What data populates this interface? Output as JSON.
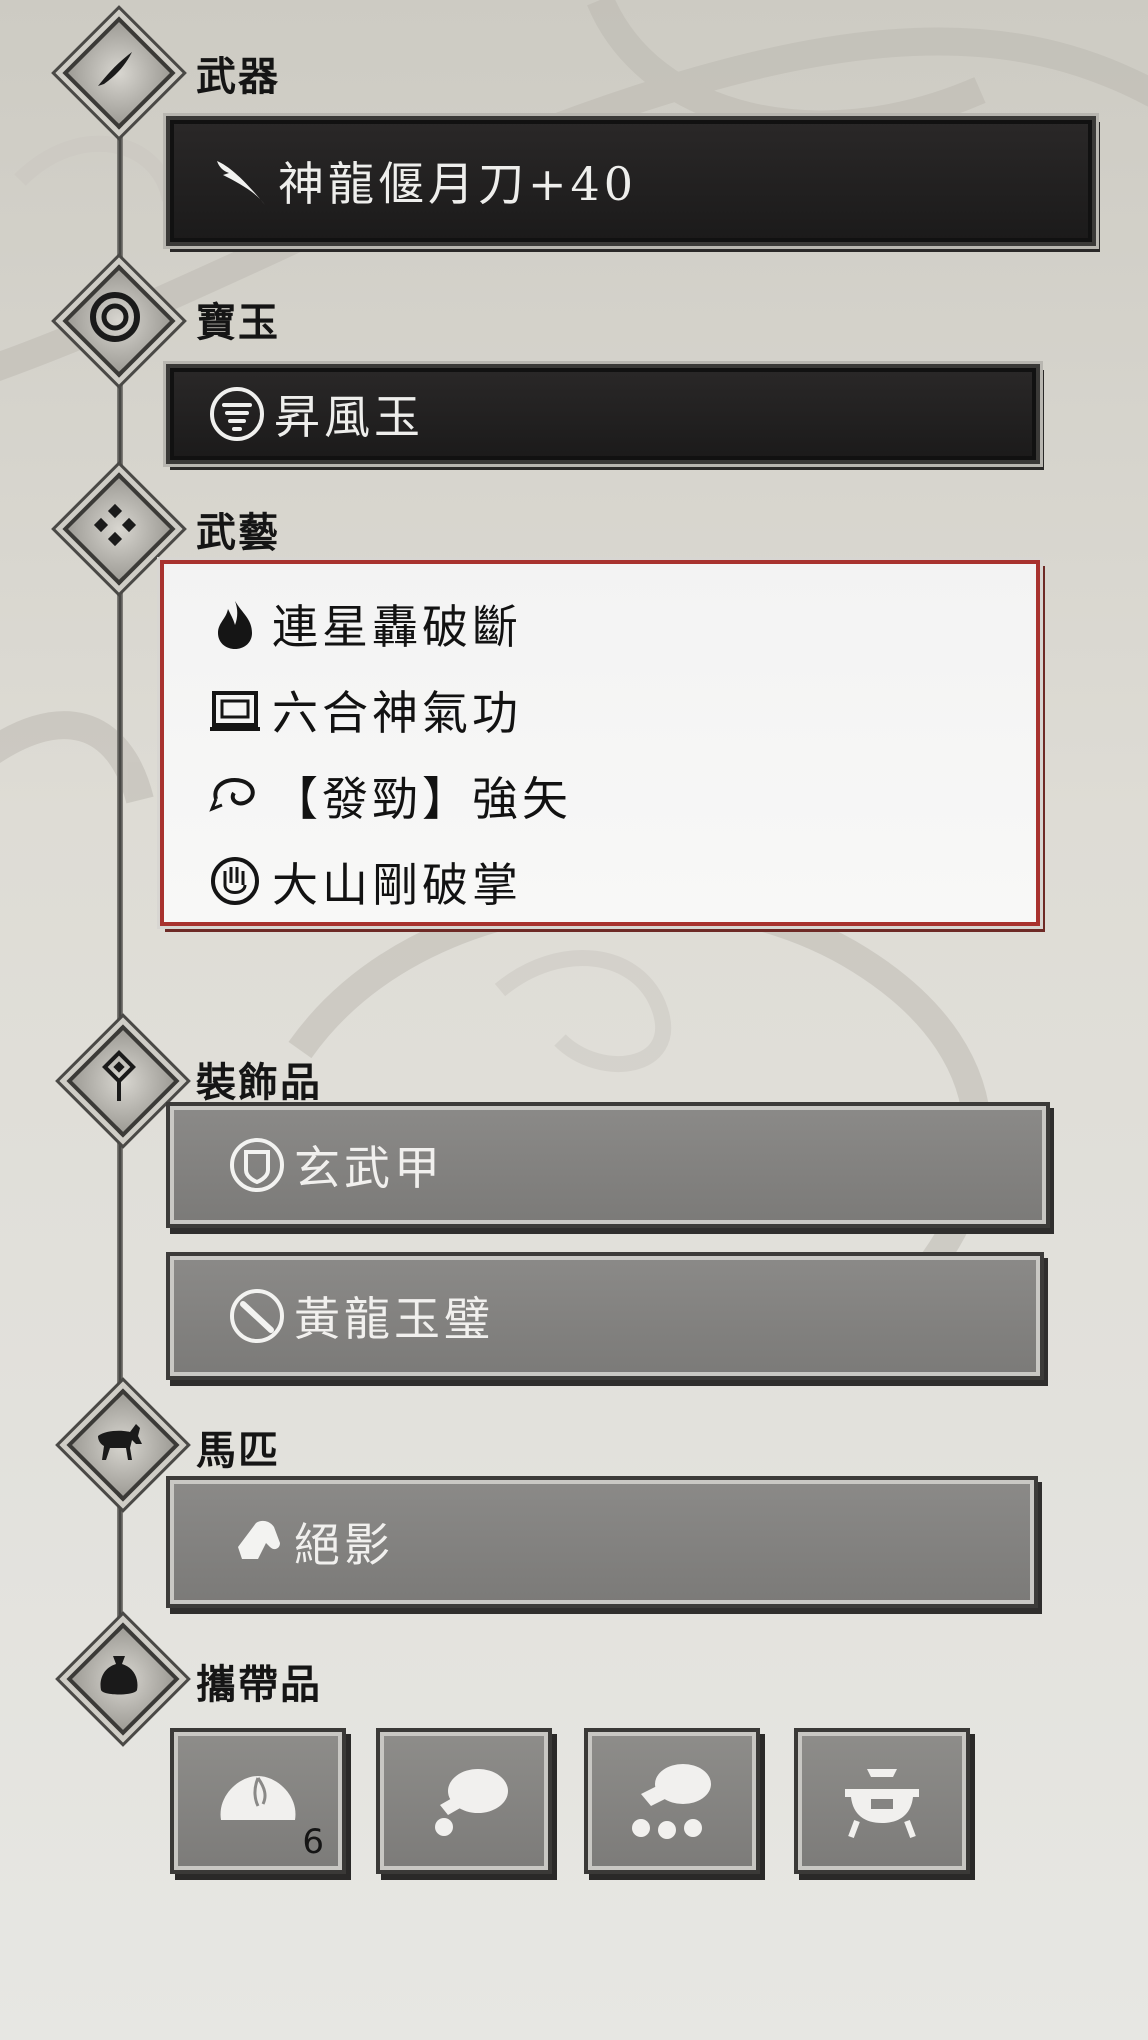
{
  "sections": {
    "weapon": {
      "label": "武器",
      "item": {
        "name": "神龍偃月刀+40",
        "icon": "blade-icon"
      }
    },
    "gem": {
      "label": "寶玉",
      "item": {
        "name": "昇風玉",
        "icon": "whirlwind-icon"
      }
    },
    "martial_arts": {
      "label": "武藝",
      "items": [
        {
          "name": "連星轟破斷",
          "icon": "flame-icon"
        },
        {
          "name": "六合神氣功",
          "icon": "frame-icon"
        },
        {
          "name": "【發勁】強矢",
          "icon": "loop-icon"
        },
        {
          "name": "大山剛破掌",
          "icon": "palm-icon"
        }
      ]
    },
    "accessory": {
      "label": "裝飾品",
      "items": [
        {
          "name": "玄武甲",
          "icon": "shield-icon"
        },
        {
          "name": "黃龍玉璧",
          "icon": "jade-disc-icon"
        }
      ]
    },
    "horse": {
      "label": "馬匹",
      "item": {
        "name": "絕影",
        "icon": "horse-head-icon"
      }
    },
    "consumables": {
      "label": "攜帶品",
      "slots": [
        {
          "icon": "steamed-bun-icon",
          "count": "6"
        },
        {
          "icon": "pouch-icon"
        },
        {
          "icon": "pouch-bundle-icon"
        },
        {
          "icon": "cauldron-icon"
        }
      ]
    }
  },
  "colors": {
    "skills_border": "#a8322e",
    "dark_bar": "#1f1e1e",
    "gray_bar": "#848381"
  }
}
